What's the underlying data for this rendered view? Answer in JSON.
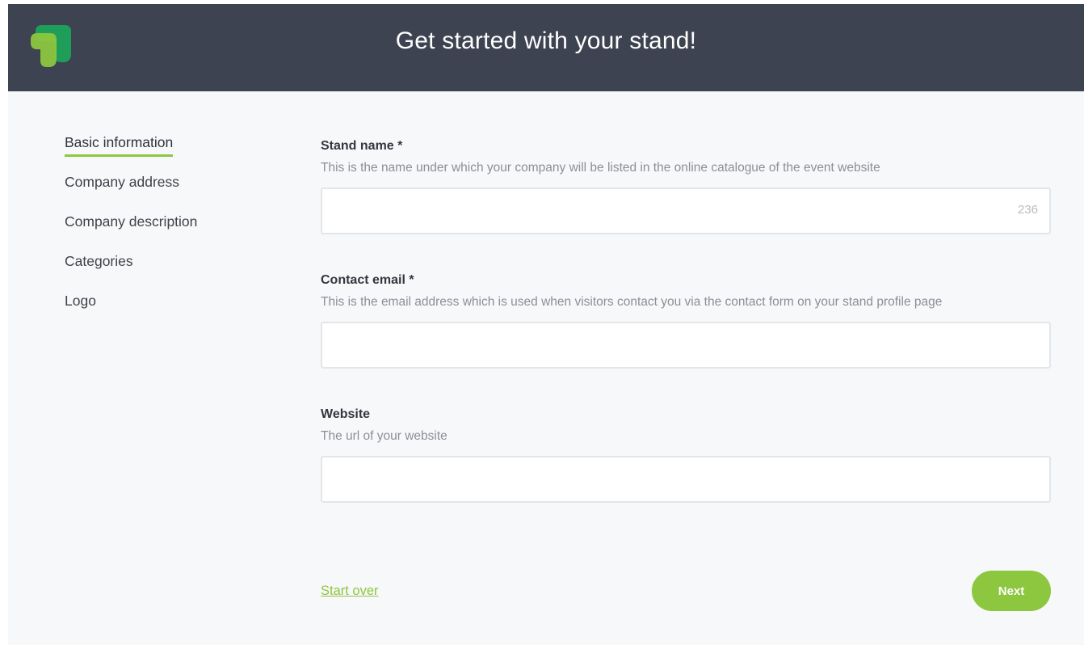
{
  "header": {
    "title": "Get started with your stand!",
    "logo_icon": "brand-logo-icon",
    "background_color": "#3d4350"
  },
  "sidebar": {
    "items": [
      {
        "label": "Basic information",
        "active": true
      },
      {
        "label": "Company address",
        "active": false
      },
      {
        "label": "Company description",
        "active": false
      },
      {
        "label": "Categories",
        "active": false
      },
      {
        "label": "Logo",
        "active": false
      }
    ]
  },
  "form": {
    "stand_name": {
      "label": "Stand name *",
      "help": "This is the name under which your company will be listed in the online catalogue of the event website",
      "value": "",
      "counter": "236"
    },
    "contact_email": {
      "label": "Contact email *",
      "help": "This is the email address which is used when visitors contact you via the contact form on your stand profile page",
      "value": ""
    },
    "website": {
      "label": "Website",
      "help": "The url of your website",
      "value": ""
    }
  },
  "actions": {
    "start_over_label": "Start over",
    "next_label": "Next"
  },
  "colors": {
    "accent": "#8dc63f",
    "logo_dark_green": "#1f9e5a",
    "logo_light_green": "#8dc63f"
  }
}
